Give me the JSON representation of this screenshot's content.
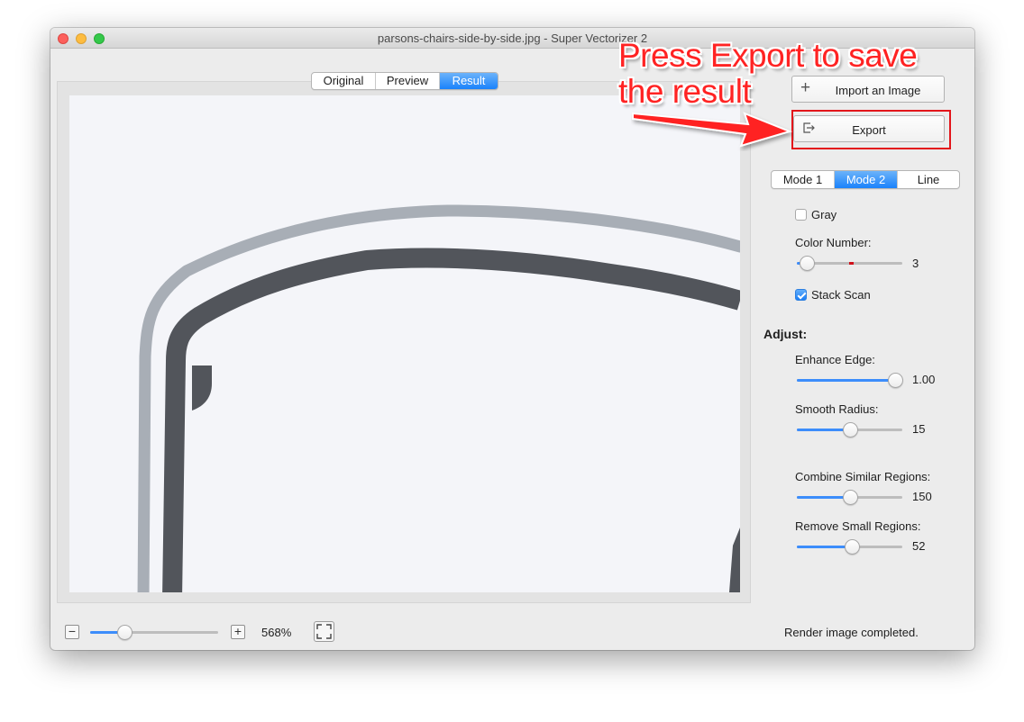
{
  "window": {
    "title": "parsons-chairs-side-by-side.jpg - Super Vectorizer 2"
  },
  "view_tabs": {
    "items": [
      "Original",
      "Preview",
      "Result"
    ],
    "active": "Result"
  },
  "toolbar": {
    "import_label": "Import an Image",
    "export_label": "Export"
  },
  "mode_tabs": {
    "items": [
      "Mode 1",
      "Mode 2",
      "Line"
    ],
    "active": "Mode 2"
  },
  "options": {
    "gray_label": "Gray",
    "gray_checked": false,
    "color_number_label": "Color Number:",
    "color_number_value": "3",
    "color_number_fraction": 0.09,
    "stack_scan_label": "Stack Scan",
    "stack_scan_checked": true
  },
  "adjust": {
    "heading": "Adjust:",
    "enhance_edge_label": "Enhance Edge:",
    "enhance_edge_value": "1.00",
    "enhance_edge_fraction": 0.93,
    "smooth_radius_label": "Smooth Radius:",
    "smooth_radius_value": "15",
    "smooth_radius_fraction": 0.5,
    "combine_label": "Combine Similar Regions:",
    "combine_value": "150",
    "combine_fraction": 0.5,
    "remove_label": "Remove Small Regions:",
    "remove_value": "52",
    "remove_fraction": 0.52
  },
  "footer": {
    "zoom_level": "568%",
    "zoom_fraction": 0.27,
    "status": "Render image completed."
  },
  "annotation": {
    "line1": "Press Export to save",
    "line2": "the result",
    "color": "#ff2323"
  },
  "colors": {
    "accent": "#1a82fb",
    "light_stroke": "#a8aeb6",
    "dark_stroke": "#52555b"
  }
}
